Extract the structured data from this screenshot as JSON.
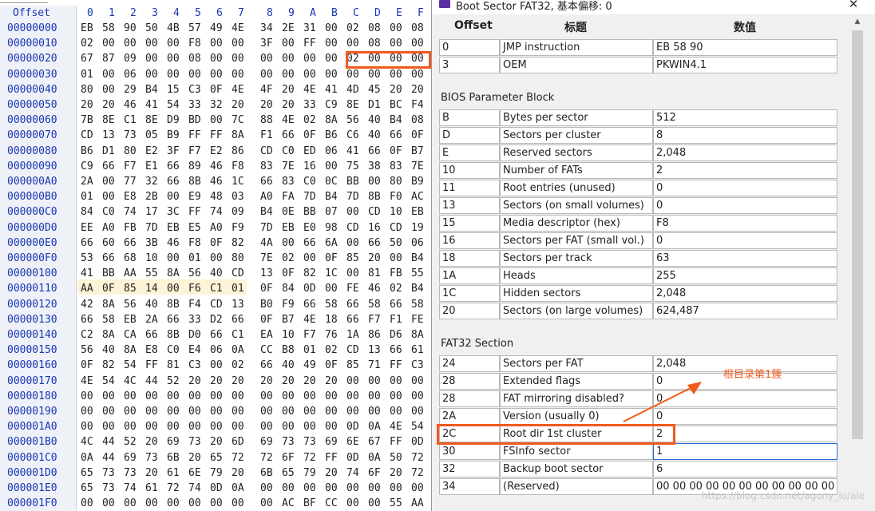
{
  "hex_editor": {
    "offset_header": "Offset",
    "column_headers": [
      "0",
      "1",
      "2",
      "3",
      "4",
      "5",
      "6",
      "7",
      "8",
      "9",
      "A",
      "B",
      "C",
      "D",
      "E",
      "F"
    ],
    "rows": [
      {
        "offset": "00000000",
        "bytes": [
          "EB",
          "58",
          "90",
          "50",
          "4B",
          "57",
          "49",
          "4E",
          "34",
          "2E",
          "31",
          "00",
          "02",
          "08",
          "00",
          "08"
        ]
      },
      {
        "offset": "00000010",
        "bytes": [
          "02",
          "00",
          "00",
          "00",
          "00",
          "F8",
          "00",
          "00",
          "3F",
          "00",
          "FF",
          "00",
          "00",
          "08",
          "00",
          "00"
        ]
      },
      {
        "offset": "00000020",
        "bytes": [
          "67",
          "87",
          "09",
          "00",
          "00",
          "08",
          "00",
          "00",
          "00",
          "00",
          "00",
          "00",
          "02",
          "00",
          "00",
          "00"
        ]
      },
      {
        "offset": "00000030",
        "bytes": [
          "01",
          "00",
          "06",
          "00",
          "00",
          "00",
          "00",
          "00",
          "00",
          "00",
          "00",
          "00",
          "00",
          "00",
          "00",
          "00"
        ]
      },
      {
        "offset": "00000040",
        "bytes": [
          "80",
          "00",
          "29",
          "B4",
          "15",
          "C3",
          "0F",
          "4E",
          "4F",
          "20",
          "4E",
          "41",
          "4D",
          "45",
          "20",
          "20"
        ]
      },
      {
        "offset": "00000050",
        "bytes": [
          "20",
          "20",
          "46",
          "41",
          "54",
          "33",
          "32",
          "20",
          "20",
          "20",
          "33",
          "C9",
          "8E",
          "D1",
          "BC",
          "F4"
        ]
      },
      {
        "offset": "00000060",
        "bytes": [
          "7B",
          "8E",
          "C1",
          "8E",
          "D9",
          "BD",
          "00",
          "7C",
          "88",
          "4E",
          "02",
          "8A",
          "56",
          "40",
          "B4",
          "08"
        ]
      },
      {
        "offset": "00000070",
        "bytes": [
          "CD",
          "13",
          "73",
          "05",
          "B9",
          "FF",
          "FF",
          "8A",
          "F1",
          "66",
          "0F",
          "B6",
          "C6",
          "40",
          "66",
          "0F"
        ]
      },
      {
        "offset": "00000080",
        "bytes": [
          "B6",
          "D1",
          "80",
          "E2",
          "3F",
          "F7",
          "E2",
          "86",
          "CD",
          "C0",
          "ED",
          "06",
          "41",
          "66",
          "0F",
          "B7"
        ]
      },
      {
        "offset": "00000090",
        "bytes": [
          "C9",
          "66",
          "F7",
          "E1",
          "66",
          "89",
          "46",
          "F8",
          "83",
          "7E",
          "16",
          "00",
          "75",
          "38",
          "83",
          "7E"
        ]
      },
      {
        "offset": "000000A0",
        "bytes": [
          "2A",
          "00",
          "77",
          "32",
          "66",
          "8B",
          "46",
          "1C",
          "66",
          "83",
          "C0",
          "0C",
          "BB",
          "00",
          "80",
          "B9"
        ]
      },
      {
        "offset": "000000B0",
        "bytes": [
          "01",
          "00",
          "E8",
          "2B",
          "00",
          "E9",
          "48",
          "03",
          "A0",
          "FA",
          "7D",
          "B4",
          "7D",
          "8B",
          "F0",
          "AC"
        ]
      },
      {
        "offset": "000000C0",
        "bytes": [
          "84",
          "C0",
          "74",
          "17",
          "3C",
          "FF",
          "74",
          "09",
          "B4",
          "0E",
          "BB",
          "07",
          "00",
          "CD",
          "10",
          "EB"
        ]
      },
      {
        "offset": "000000D0",
        "bytes": [
          "EE",
          "A0",
          "FB",
          "7D",
          "EB",
          "E5",
          "A0",
          "F9",
          "7D",
          "EB",
          "E0",
          "98",
          "CD",
          "16",
          "CD",
          "19"
        ]
      },
      {
        "offset": "000000E0",
        "bytes": [
          "66",
          "60",
          "66",
          "3B",
          "46",
          "F8",
          "0F",
          "82",
          "4A",
          "00",
          "66",
          "6A",
          "00",
          "66",
          "50",
          "06"
        ]
      },
      {
        "offset": "000000F0",
        "bytes": [
          "53",
          "66",
          "68",
          "10",
          "00",
          "01",
          "00",
          "80",
          "7E",
          "02",
          "00",
          "0F",
          "85",
          "20",
          "00",
          "B4"
        ]
      },
      {
        "offset": "00000100",
        "bytes": [
          "41",
          "BB",
          "AA",
          "55",
          "8A",
          "56",
          "40",
          "CD",
          "13",
          "0F",
          "82",
          "1C",
          "00",
          "81",
          "FB",
          "55"
        ]
      },
      {
        "offset": "00000110",
        "bytes": [
          "AA",
          "0F",
          "85",
          "14",
          "00",
          "F6",
          "C1",
          "01",
          "0F",
          "84",
          "0D",
          "00",
          "FE",
          "46",
          "02",
          "B4"
        ]
      },
      {
        "offset": "00000120",
        "bytes": [
          "42",
          "8A",
          "56",
          "40",
          "8B",
          "F4",
          "CD",
          "13",
          "B0",
          "F9",
          "66",
          "58",
          "66",
          "58",
          "66",
          "58"
        ]
      },
      {
        "offset": "00000130",
        "bytes": [
          "66",
          "58",
          "EB",
          "2A",
          "66",
          "33",
          "D2",
          "66",
          "0F",
          "B7",
          "4E",
          "18",
          "66",
          "F7",
          "F1",
          "FE"
        ]
      },
      {
        "offset": "00000140",
        "bytes": [
          "C2",
          "8A",
          "CA",
          "66",
          "8B",
          "D0",
          "66",
          "C1",
          "EA",
          "10",
          "F7",
          "76",
          "1A",
          "86",
          "D6",
          "8A"
        ]
      },
      {
        "offset": "00000150",
        "bytes": [
          "56",
          "40",
          "8A",
          "E8",
          "C0",
          "E4",
          "06",
          "0A",
          "CC",
          "B8",
          "01",
          "02",
          "CD",
          "13",
          "66",
          "61"
        ]
      },
      {
        "offset": "00000160",
        "bytes": [
          "0F",
          "82",
          "54",
          "FF",
          "81",
          "C3",
          "00",
          "02",
          "66",
          "40",
          "49",
          "0F",
          "85",
          "71",
          "FF",
          "C3"
        ]
      },
      {
        "offset": "00000170",
        "bytes": [
          "4E",
          "54",
          "4C",
          "44",
          "52",
          "20",
          "20",
          "20",
          "20",
          "20",
          "20",
          "20",
          "00",
          "00",
          "00",
          "00"
        ]
      },
      {
        "offset": "00000180",
        "bytes": [
          "00",
          "00",
          "00",
          "00",
          "00",
          "00",
          "00",
          "00",
          "00",
          "00",
          "00",
          "00",
          "00",
          "00",
          "00",
          "00"
        ]
      },
      {
        "offset": "00000190",
        "bytes": [
          "00",
          "00",
          "00",
          "00",
          "00",
          "00",
          "00",
          "00",
          "00",
          "00",
          "00",
          "00",
          "00",
          "00",
          "00",
          "00"
        ]
      },
      {
        "offset": "000001A0",
        "bytes": [
          "00",
          "00",
          "00",
          "00",
          "00",
          "00",
          "00",
          "00",
          "00",
          "00",
          "00",
          "00",
          "0D",
          "0A",
          "4E",
          "54"
        ]
      },
      {
        "offset": "000001B0",
        "bytes": [
          "4C",
          "44",
          "52",
          "20",
          "69",
          "73",
          "20",
          "6D",
          "69",
          "73",
          "73",
          "69",
          "6E",
          "67",
          "FF",
          "0D"
        ]
      },
      {
        "offset": "000001C0",
        "bytes": [
          "0A",
          "44",
          "69",
          "73",
          "6B",
          "20",
          "65",
          "72",
          "72",
          "6F",
          "72",
          "FF",
          "0D",
          "0A",
          "50",
          "72"
        ]
      },
      {
        "offset": "000001D0",
        "bytes": [
          "65",
          "73",
          "73",
          "20",
          "61",
          "6E",
          "79",
          "20",
          "6B",
          "65",
          "79",
          "20",
          "74",
          "6F",
          "20",
          "72"
        ]
      },
      {
        "offset": "000001E0",
        "bytes": [
          "65",
          "73",
          "74",
          "61",
          "72",
          "74",
          "0D",
          "0A",
          "00",
          "00",
          "00",
          "00",
          "00",
          "00",
          "00",
          "00"
        ]
      },
      {
        "offset": "000001F0",
        "bytes": [
          "00",
          "00",
          "00",
          "00",
          "00",
          "00",
          "00",
          "00",
          "00",
          "AC",
          "BF",
          "CC",
          "00",
          "00",
          "55",
          "AA"
        ]
      }
    ]
  },
  "dialog": {
    "title": "Boot Sector FAT32, 基本偏移: 0",
    "close_glyph": "✕",
    "scroll_up_glyph": "▲",
    "headers": {
      "offset": "Offset",
      "title": "标题",
      "value": "数值"
    },
    "top_rows": [
      {
        "offset": "0",
        "title": "JMP instruction",
        "value": "EB 58 90"
      },
      {
        "offset": "3",
        "title": "OEM",
        "value": "PKWIN4.1"
      }
    ],
    "bpb_section": "BIOS Parameter Block",
    "bpb_rows": [
      {
        "offset": "B",
        "title": "Bytes per sector",
        "value": "512"
      },
      {
        "offset": "D",
        "title": "Sectors per cluster",
        "value": "8"
      },
      {
        "offset": "E",
        "title": "Reserved sectors",
        "value": "2,048"
      },
      {
        "offset": "10",
        "title": "Number of FATs",
        "value": "2"
      },
      {
        "offset": "11",
        "title": "Root entries (unused)",
        "value": "0"
      },
      {
        "offset": "13",
        "title": "Sectors (on small volumes)",
        "value": "0"
      },
      {
        "offset": "15",
        "title": "Media descriptor (hex)",
        "value": "F8"
      },
      {
        "offset": "16",
        "title": "Sectors per FAT (small vol.)",
        "value": "0"
      },
      {
        "offset": "18",
        "title": "Sectors per track",
        "value": "63"
      },
      {
        "offset": "1A",
        "title": "Heads",
        "value": "255"
      },
      {
        "offset": "1C",
        "title": "Hidden sectors",
        "value": "2,048"
      },
      {
        "offset": "20",
        "title": "Sectors (on large volumes)",
        "value": "624,487"
      }
    ],
    "fat32_section": "FAT32 Section",
    "fat32_rows": [
      {
        "offset": "24",
        "title": "Sectors per FAT",
        "value": "2,048"
      },
      {
        "offset": "28",
        "title": "Extended flags",
        "value": "0"
      },
      {
        "offset": "28",
        "title": "FAT mirroring disabled?",
        "value": "0"
      },
      {
        "offset": "2A",
        "title": "Version (usually 0)",
        "value": "0"
      },
      {
        "offset": "2C",
        "title": "Root dir 1st cluster",
        "value": "2"
      },
      {
        "offset": "30",
        "title": "FSInfo sector",
        "value": "1"
      },
      {
        "offset": "32",
        "title": "Backup boot sector",
        "value": "6"
      },
      {
        "offset": "34",
        "title": "(Reserved)",
        "value": "00 00 00 00 00 00 00 00 00 00 00 00"
      }
    ]
  },
  "annotation": {
    "text": "根目录第1簇",
    "color": "#f25c1f"
  },
  "watermark": "https://blog.csdn.net/agony_lo/ale",
  "colors": {
    "accent": "#f05a1c",
    "offset_blue": "#1a36b5",
    "highlight": "#fdf3d6"
  }
}
